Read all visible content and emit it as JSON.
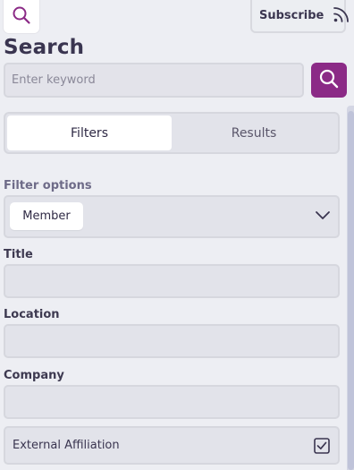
{
  "header": {
    "subscribe_label": "Subscribe"
  },
  "search": {
    "title": "Search",
    "placeholder": "Enter keyword",
    "value": ""
  },
  "tabs": [
    {
      "label": "Filters",
      "active": true
    },
    {
      "label": "Results",
      "active": false
    }
  ],
  "filters": {
    "heading": "Filter options",
    "selected_option": "Member",
    "fields": [
      {
        "label": "Title",
        "value": ""
      },
      {
        "label": "Location",
        "value": ""
      },
      {
        "label": "Company",
        "value": ""
      }
    ],
    "external_affiliation": {
      "label": "External Affiliation",
      "checked": true
    }
  },
  "colors": {
    "accent": "#8b2a86",
    "background": "#edeef3",
    "field_fill": "#e2e3ea",
    "text": "#3a3550"
  },
  "icons": {
    "header_search": "search-icon",
    "subscribe": "rss-icon",
    "search_submit": "search-icon",
    "select": "chevron-down-icon",
    "affiliation": "checkbox-checked-icon"
  }
}
